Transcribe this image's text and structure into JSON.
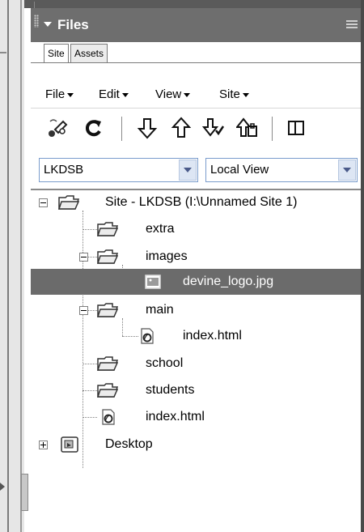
{
  "panel": {
    "title": "Files"
  },
  "tabs": [
    {
      "label": "Site"
    },
    {
      "label": "Assets"
    }
  ],
  "menus": [
    {
      "label": "File"
    },
    {
      "label": "Edit"
    },
    {
      "label": "View"
    },
    {
      "label": "Site"
    }
  ],
  "toolbar": {
    "buttons": [
      "connect-icon",
      "refresh-icon",
      "get-files-icon",
      "put-files-icon",
      "check-out-icon",
      "check-in-icon",
      "expand-icon"
    ]
  },
  "site_select": {
    "value": "LKDSB"
  },
  "view_select": {
    "value": "Local View"
  },
  "tree": {
    "root": "Site - LKDSB (I:\\Unnamed Site 1)",
    "extra": "extra",
    "images": "images",
    "devine_logo": "devine_logo.jpg",
    "main": "main",
    "main_index": "index.html",
    "school": "school",
    "students": "students",
    "root_index": "index.html",
    "desktop": "Desktop"
  },
  "colors": {
    "title_bar": "#6e6e6e",
    "selection": "#6b6b6b",
    "select_border": "#7a9ccc"
  }
}
